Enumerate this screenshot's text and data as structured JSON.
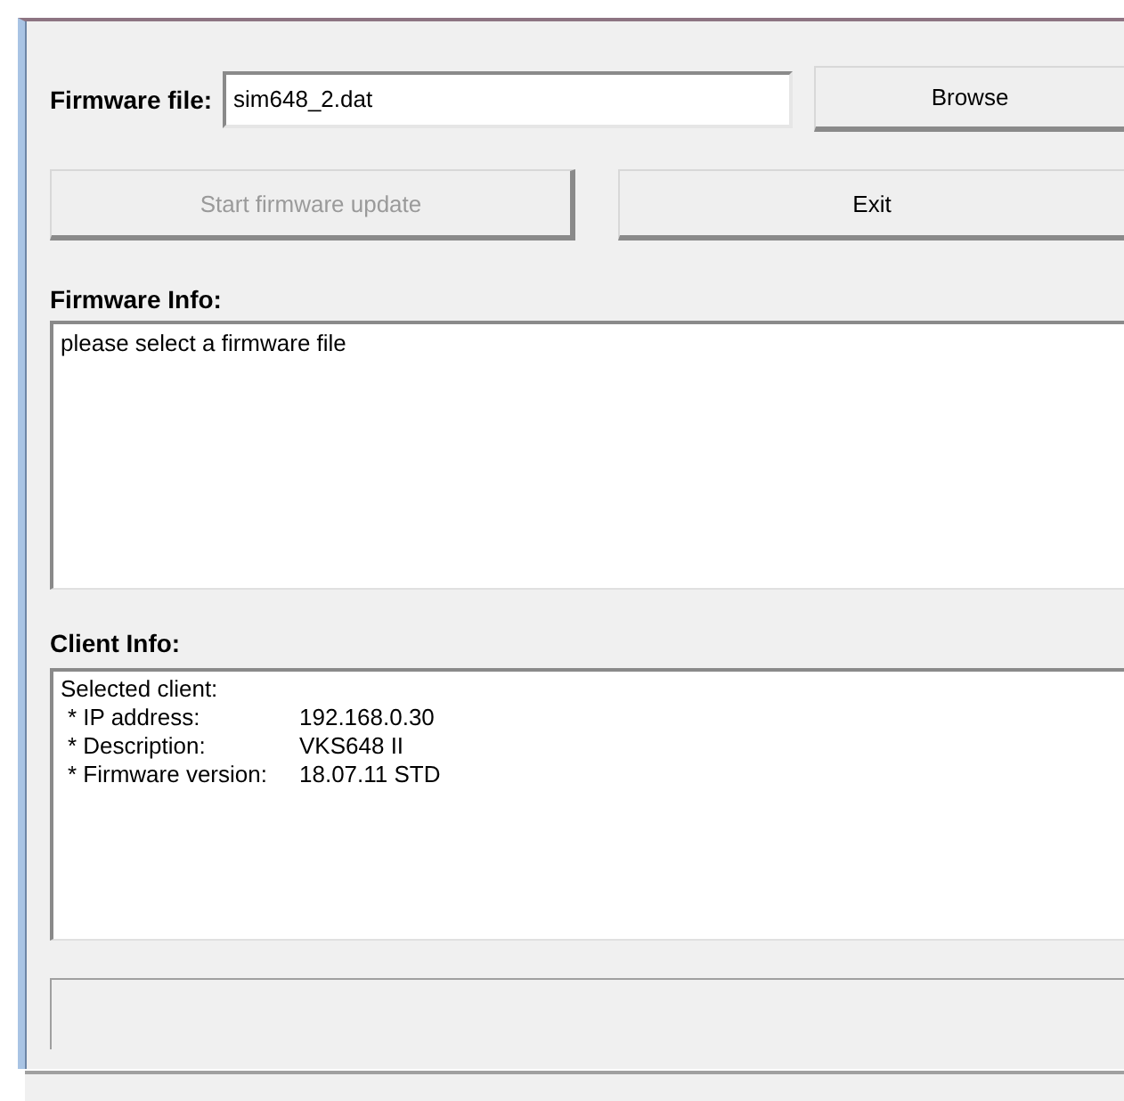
{
  "firmware_file": {
    "label": "Firmware file:",
    "value": "sim648_2.dat"
  },
  "buttons": [
    {
      "kind": "browse",
      "label": "Browse",
      "disabled": false
    },
    {
      "kind": "start",
      "label": "Start firmware update",
      "disabled": true
    },
    {
      "kind": "exit",
      "label": "Exit",
      "disabled": false
    }
  ],
  "firmware_info": {
    "heading": "Firmware Info:",
    "text": "please select a firmware file"
  },
  "client_info": {
    "heading": "Client Info:",
    "intro": "Selected client:",
    "rows": [
      {
        "label": "* IP address:",
        "value": "192.168.0.30"
      },
      {
        "label": "* Description:",
        "value": "VKS648 II"
      },
      {
        "label": "* Firmware version:",
        "value": "18.07.11 STD"
      }
    ]
  }
}
